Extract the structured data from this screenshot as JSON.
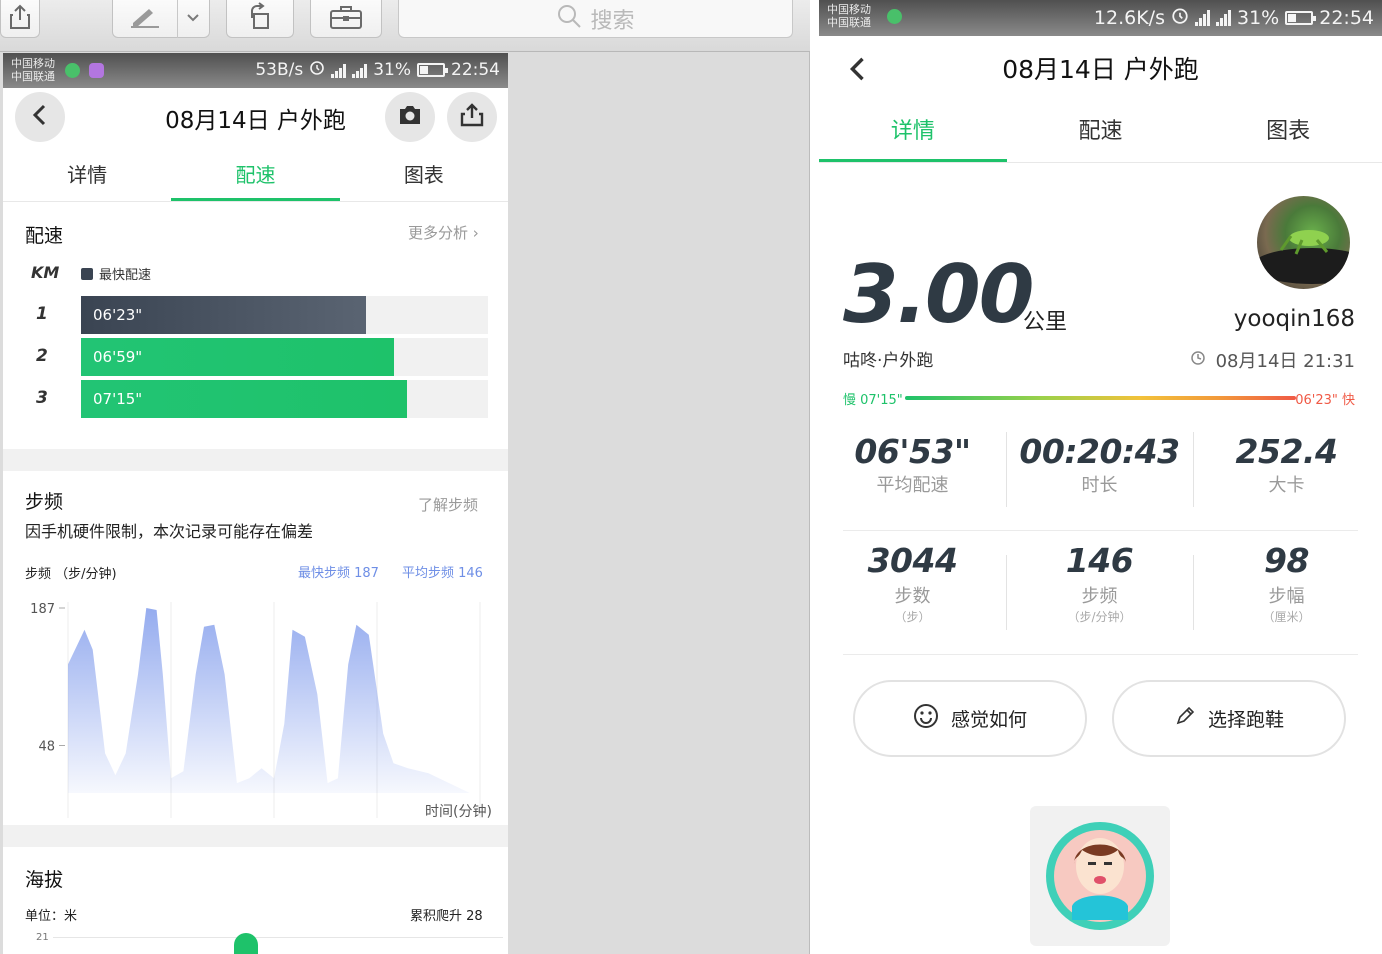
{
  "mac_toolbar": {
    "search_label": "搜索"
  },
  "phone1": {
    "status": {
      "carrier_1": "中国移动",
      "carrier_2": "中国联通",
      "speed": "53B/s",
      "battery": "31%",
      "time": "22:54"
    },
    "title": "08月14日 户外跑",
    "tabs": [
      "详情",
      "配速",
      "图表"
    ],
    "active_tab": 1,
    "pace": {
      "title": "配速",
      "more_link": "更多分析",
      "km_label": "KM",
      "legend_label": "最快配速",
      "rows": [
        {
          "km": "1",
          "pace": "06'23\"",
          "fraction": 0.7,
          "fastest": true
        },
        {
          "km": "2",
          "pace": "06'59\"",
          "fraction": 0.77,
          "fastest": false
        },
        {
          "km": "3",
          "pace": "07'15\"",
          "fraction": 0.8,
          "fastest": false
        }
      ]
    },
    "cadence": {
      "title": "步频",
      "learn_link": "了解步频",
      "note": "因手机硬件限制，本次记录可能存在偏差",
      "axis_title": "步频 （步/分钟)",
      "max_label": "最快步频 187",
      "avg_label": "平均步频 146",
      "xlabel": "时间(分钟)"
    },
    "altitude": {
      "title": "海拔",
      "unit_label": "单位：米",
      "climb_label": "累积爬升 28",
      "tick_21": "21"
    }
  },
  "chart_data": {
    "type": "area",
    "title": "步频",
    "ylabel": "步频 （步/分钟)",
    "xlabel": "时间(分钟)",
    "xlim": [
      0,
      20
    ],
    "ylim": [
      0,
      187
    ],
    "x_ticks": [
      "0",
      "5",
      "10",
      "15",
      "20"
    ],
    "y_ticks": [
      "187",
      "48"
    ],
    "grid": true,
    "color": "#8fa7ee",
    "x": [
      0,
      0.8,
      1.2,
      1.8,
      2.3,
      2.8,
      3.4,
      3.8,
      4.3,
      4.6,
      5.0,
      5.6,
      6.2,
      6.6,
      7.1,
      7.6,
      8.2,
      8.8,
      9.4,
      10.0,
      10.5,
      10.9,
      11.5,
      12.1,
      12.6,
      13.1,
      13.6,
      14.0,
      14.6,
      15.3,
      15.8,
      16.5,
      17.5,
      18.5,
      19.5
    ],
    "y": [
      130,
      165,
      145,
      40,
      18,
      40,
      120,
      187,
      185,
      120,
      15,
      22,
      120,
      168,
      170,
      120,
      10,
      15,
      25,
      15,
      70,
      165,
      158,
      100,
      10,
      15,
      130,
      170,
      160,
      60,
      30,
      25,
      20,
      10,
      0
    ],
    "max_cadence": 187,
    "avg_cadence": 146
  },
  "phone2": {
    "status": {
      "carrier_1": "中国移动",
      "carrier_2": "中国联通",
      "speed": "12.6K/s",
      "battery": "31%",
      "time": "22:54"
    },
    "title": "08月14日 户外跑",
    "tabs": [
      "详情",
      "配速",
      "图表"
    ],
    "active_tab": 0,
    "distance": "3.00",
    "distance_unit": "公里",
    "activity": "咕咚·户外跑",
    "username": "yooqin168",
    "datetime": "08月14日 21:31",
    "pace_scale": {
      "slow_label": "慢 07'15\"",
      "fast_label": "06'23\" 快"
    },
    "stats_row1": [
      {
        "value": "06'53\"",
        "label": "平均配速"
      },
      {
        "value": "00:20:43",
        "label": "时长"
      },
      {
        "value": "252.4",
        "label": "大卡"
      }
    ],
    "stats_row2": [
      {
        "value": "3044",
        "label": "步数",
        "unit": "（步）"
      },
      {
        "value": "146",
        "label": "步频",
        "unit": "（步/分钟）"
      },
      {
        "value": "98",
        "label": "步幅",
        "unit": "（厘米）"
      }
    ],
    "buttons": {
      "feeling": "感觉如何",
      "shoes": "选择跑鞋"
    },
    "colors": {
      "accent_green": "#1ec26a",
      "pace_dark": "#3a4452",
      "fast_red": "#f05a46"
    }
  }
}
